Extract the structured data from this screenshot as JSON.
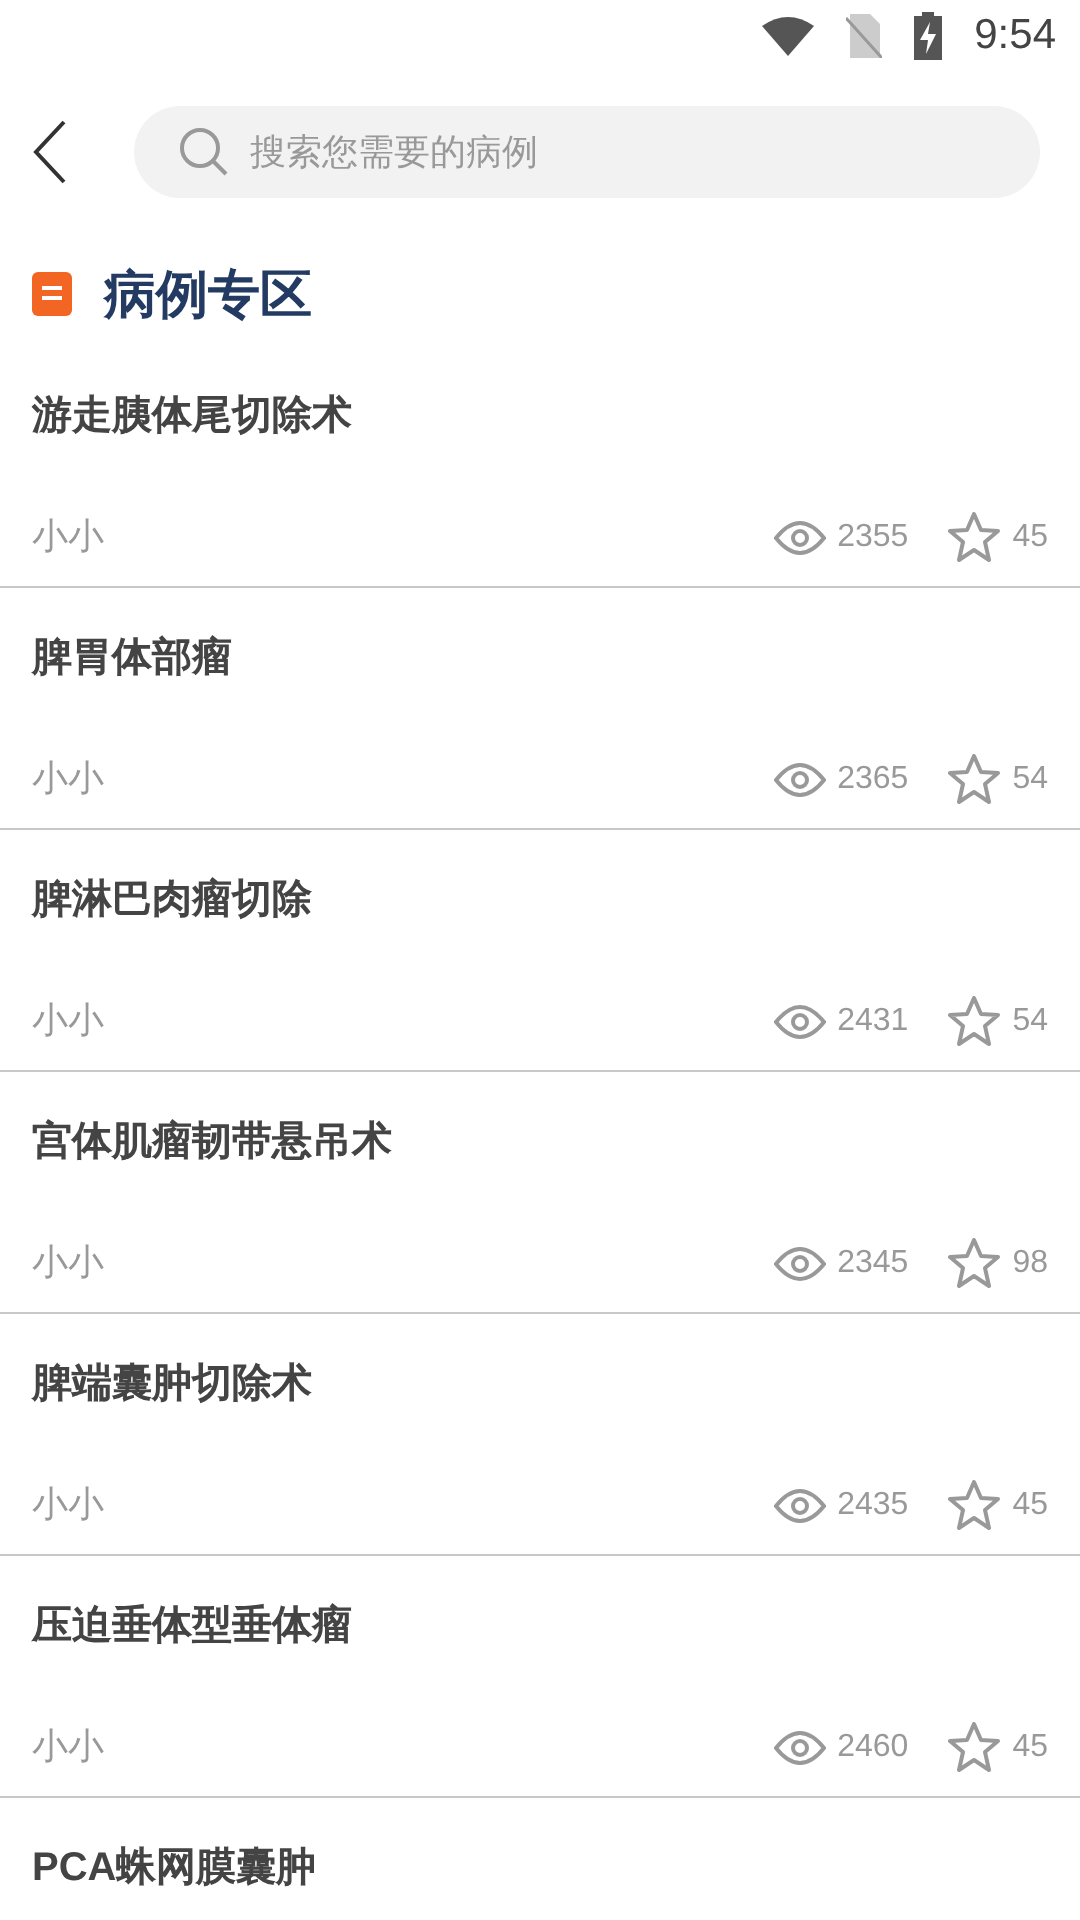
{
  "status_bar": {
    "time": "9:54"
  },
  "search": {
    "placeholder": "搜索您需要的病例"
  },
  "section": {
    "title": "病例专区"
  },
  "cases": [
    {
      "title": "游走胰体尾切除术",
      "author": "小小",
      "views": "2355",
      "favorites": "45"
    },
    {
      "title": "脾胃体部瘤",
      "author": "小小",
      "views": "2365",
      "favorites": "54"
    },
    {
      "title": "脾淋巴肉瘤切除",
      "author": "小小",
      "views": "2431",
      "favorites": "54"
    },
    {
      "title": "宫体肌瘤韧带悬吊术",
      "author": "小小",
      "views": "2345",
      "favorites": "98"
    },
    {
      "title": "脾端囊肿切除术",
      "author": "小小",
      "views": "2435",
      "favorites": "45"
    },
    {
      "title": "压迫垂体型垂体瘤",
      "author": "小小",
      "views": "2460",
      "favorites": "45"
    },
    {
      "title": "PCA蛛网膜囊肿"
    }
  ]
}
